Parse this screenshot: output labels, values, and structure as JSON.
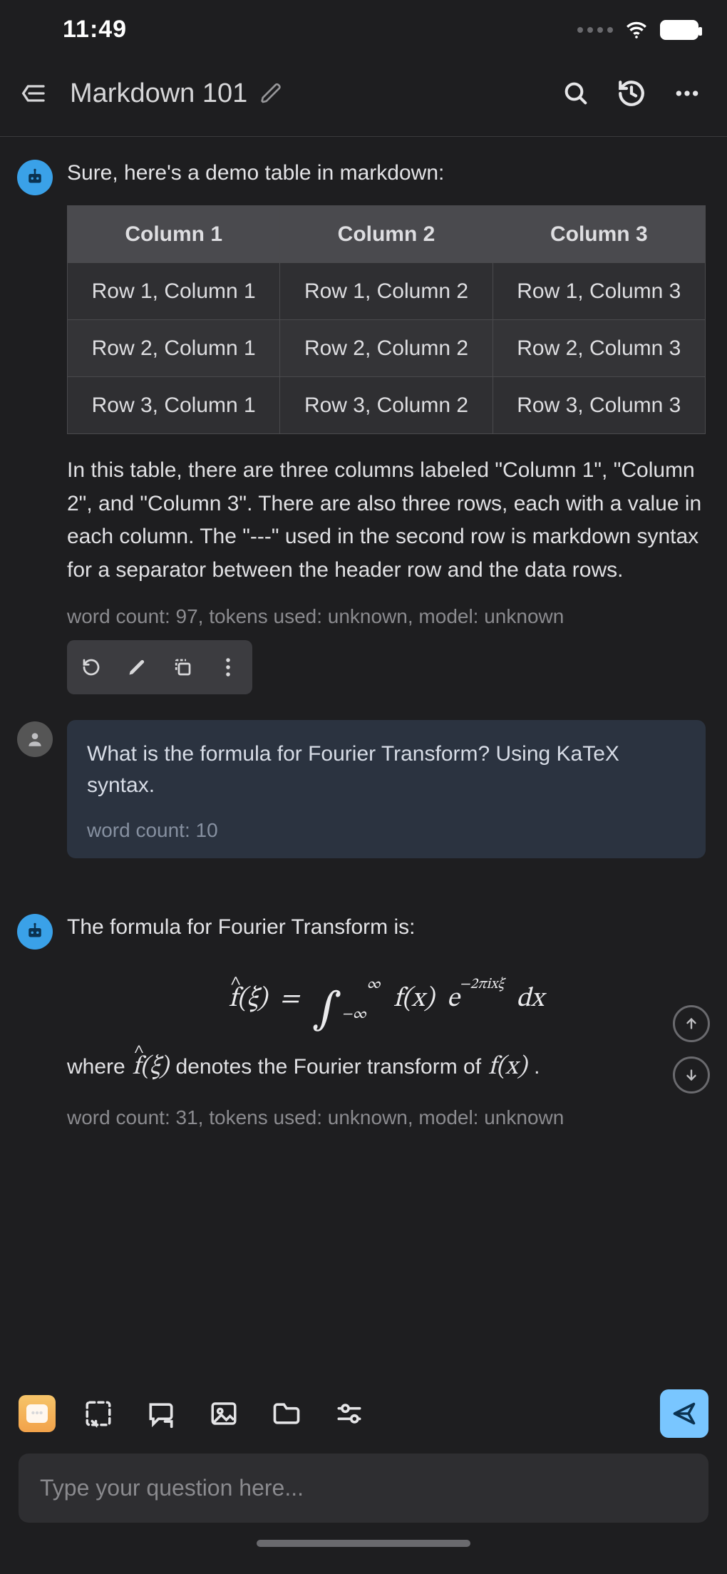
{
  "status": {
    "time": "11:49"
  },
  "header": {
    "title": "Markdown 101"
  },
  "messages": {
    "bot1": {
      "intro": "Sure, here's a demo table in markdown:",
      "table": {
        "headers": [
          "Column 1",
          "Column 2",
          "Column 3"
        ],
        "rows": [
          [
            "Row 1, Column 1",
            "Row 1, Column 2",
            "Row 1, Column 3"
          ],
          [
            "Row 2, Column 1",
            "Row 2, Column 2",
            "Row 2, Column 3"
          ],
          [
            "Row 3, Column 1",
            "Row 3, Column 2",
            "Row 3, Column 3"
          ]
        ]
      },
      "explanation": "In this table, there are three columns labeled \"Column 1\", \"Column 2\", and \"Column 3\". There are also three rows, each with a value in each column. The \"---\" used in the second row is markdown syntax for a separator between the header row and the data rows.",
      "meta": "word count: 97, tokens used: unknown, model: unknown"
    },
    "user1": {
      "text": "What is the formula for Fourier Transform? Using KaTeX syntax.",
      "meta": "word count: 10"
    },
    "bot2": {
      "intro": "The formula for Fourier Transform is:",
      "formula": {
        "display": "f̂(ξ) = ∫_{-∞}^{∞} f(x) e^{-2πixξ} dx",
        "lhs_var": "f",
        "lhs_arg": "ξ",
        "int_lower": "−∞",
        "int_upper": "∞",
        "integrand_fn": "f",
        "integrand_arg": "x",
        "exp_text": "−2πixξ",
        "diff": "dx"
      },
      "where_prefix": "where",
      "where_expr1": "f̂(ξ)",
      "where_mid": "denotes the Fourier transform of",
      "where_expr2": "f(x)",
      "where_suffix": ".",
      "meta": "word count: 31, tokens used: unknown, model: unknown"
    }
  },
  "input": {
    "placeholder": "Type your question here..."
  },
  "icons": {
    "menu": "menu-icon",
    "search": "search-icon",
    "history": "history-icon",
    "more": "more-icon"
  }
}
